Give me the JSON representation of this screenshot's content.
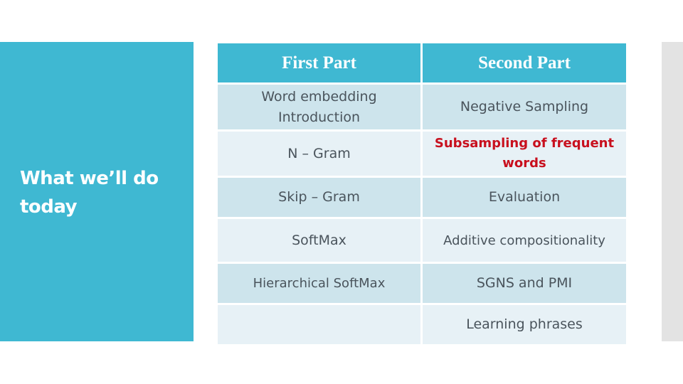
{
  "slide": {
    "title": "What we’ll do today",
    "accent_color": "#3fb8d2",
    "highlight_color": "#c8101e"
  },
  "table": {
    "headers": [
      "First Part",
      "Second Part"
    ],
    "rows": [
      {
        "first": "Word embedding Introduction",
        "second": "Negative Sampling",
        "second_highlight": false
      },
      {
        "first": "N – Gram",
        "second": "Subsampling of frequent words",
        "second_highlight": true
      },
      {
        "first": "Skip – Gram",
        "second": "Evaluation",
        "second_highlight": false
      },
      {
        "first": "SoftMax",
        "second": "Additive compositionality",
        "second_highlight": false
      },
      {
        "first": "Hierarchical SoftMax",
        "second": "SGNS and PMI",
        "second_highlight": false
      },
      {
        "first": "",
        "second": "Learning phrases",
        "second_highlight": false
      }
    ]
  }
}
